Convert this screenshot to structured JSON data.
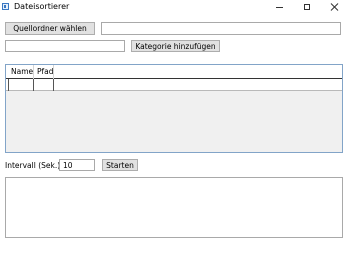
{
  "window": {
    "title": "Dateisortierer",
    "controls": {
      "minimize": "minimize-icon",
      "maximize": "maximize-icon",
      "close": "close-icon"
    }
  },
  "source": {
    "button_label": "Quellordner wählen",
    "path_value": ""
  },
  "category": {
    "input_value": "",
    "button_label": "Kategorie hinzufügen"
  },
  "list": {
    "columns": [
      "Name",
      "Pfad"
    ],
    "rows": [
      [
        "",
        ""
      ]
    ]
  },
  "interval": {
    "label": "Intervall (Sek.):",
    "value": "10",
    "start_label": "Starten"
  },
  "log": {
    "text": ""
  },
  "colors": {
    "button_bg": "#e1e1e1",
    "button_border": "#adadad",
    "list_border": "#82a4c8",
    "list_bg": "#f0f0f0"
  }
}
